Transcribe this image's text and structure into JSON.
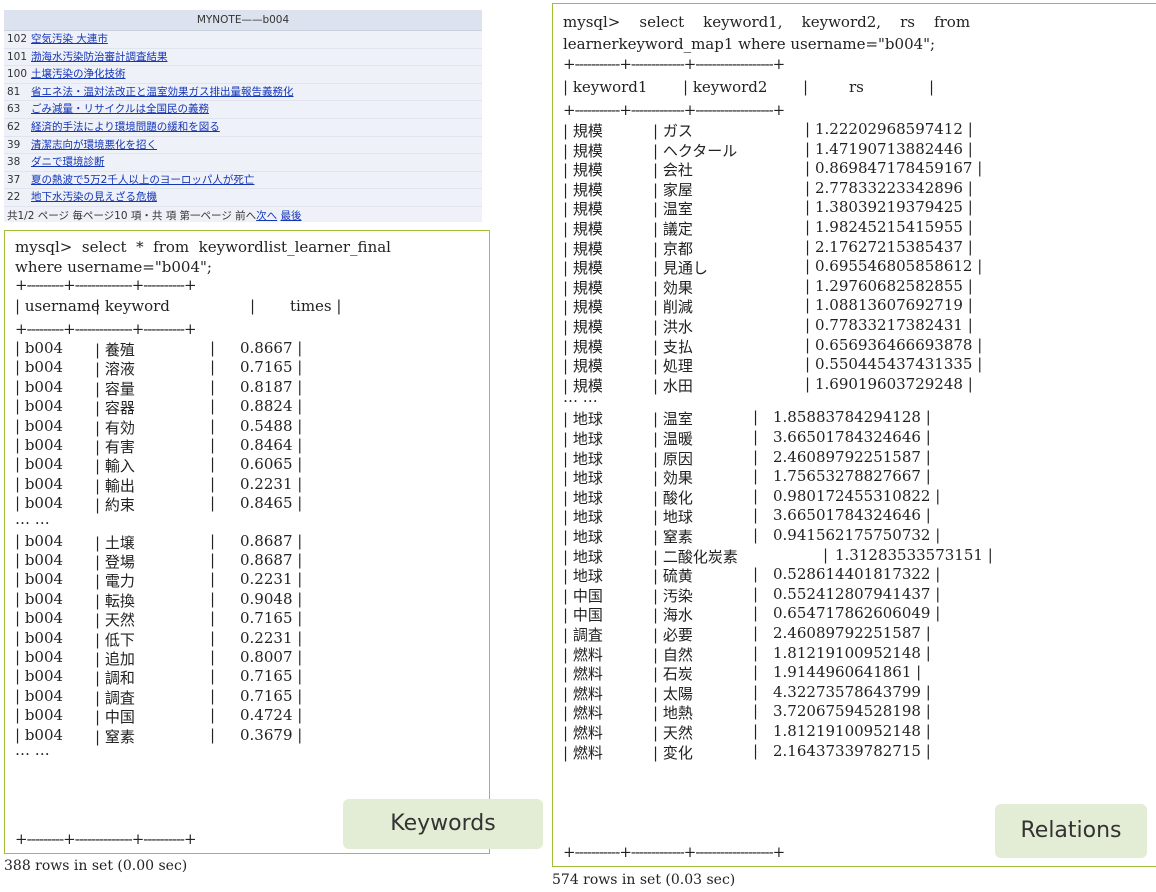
{
  "mynote": {
    "title": "MYNOTE——b004",
    "rows": [
      {
        "num": "102",
        "text": "空気汚染 大連市"
      },
      {
        "num": "101",
        "text": "渤海水汚染防治審計調査結果"
      },
      {
        "num": "100",
        "text": "土壌汚染の浄化技術"
      },
      {
        "num": "81",
        "text": "省エネ法・温対法改正と温室効果ガス排出量報告義務化"
      },
      {
        "num": "63",
        "text": "ごみ減量・リサイクルは全国民の義務"
      },
      {
        "num": "62",
        "text": "経済的手法により環境問題の緩和を図る"
      },
      {
        "num": "39",
        "text": "清潔志向が環境悪化を招く"
      },
      {
        "num": "38",
        "text": "ダニで環境診断"
      },
      {
        "num": "37",
        "text": "夏の熱波で5万2千人以上のヨーロッパ人が死亡"
      },
      {
        "num": "22",
        "text": "地下水汚染の見えざる危機"
      }
    ],
    "footer_text": "共1/2 ページ 毎ページ10 項・共 項 第一ページ 前へ",
    "footer_next": "次へ",
    "footer_last": "最後"
  },
  "keywords_panel": {
    "query_line1": "mysql>  select  *  from  keywordlist_learner_final",
    "query_line2": "where username=\"b004\";",
    "separator": "+---------+--------------+----------+",
    "headers": [
      "| username",
      "| keyword",
      "|",
      "times |"
    ],
    "rows_a": [
      [
        "| b004",
        "| 養殖",
        "|",
        "0.8667 |"
      ],
      [
        "| b004",
        "| 溶液",
        "|",
        "0.7165 |"
      ],
      [
        "| b004",
        "| 容量",
        "|",
        "0.8187 |"
      ],
      [
        "| b004",
        "| 容器",
        "|",
        "0.8824 |"
      ],
      [
        "| b004",
        "| 有効",
        "|",
        "0.5488 |"
      ],
      [
        "| b004",
        "| 有害",
        "|",
        "0.8464 |"
      ],
      [
        "| b004",
        "| 輸入",
        "|",
        "0.6065 |"
      ],
      [
        "| b004",
        "| 輸出",
        "|",
        "0.2231 |"
      ],
      [
        "| b004",
        "| 約束",
        "|",
        "0.8465 |"
      ]
    ],
    "ellipsis": "… …",
    "rows_b": [
      [
        "| b004",
        "| 土壌",
        "|",
        "0.8687 |"
      ],
      [
        "| b004",
        "| 登場",
        "|",
        "0.8687 |"
      ],
      [
        "| b004",
        "| 電力",
        "|",
        "0.2231 |"
      ],
      [
        "| b004",
        "| 転換",
        "|",
        "0.9048 |"
      ],
      [
        "| b004",
        "| 天然",
        "|",
        "0.7165 |"
      ],
      [
        "| b004",
        "| 低下",
        "|",
        "0.2231 |"
      ],
      [
        "| b004",
        "| 追加",
        "|",
        "0.8007 |"
      ],
      [
        "| b004",
        "| 調和",
        "|",
        "0.7165 |"
      ],
      [
        "| b004",
        "| 調査",
        "|",
        "0.7165 |"
      ],
      [
        "| b004",
        "| 中国",
        "|",
        "0.4724 |"
      ],
      [
        "| b004",
        "| 窒素",
        "|",
        "0.3679 |"
      ]
    ],
    "status": "388 rows in set (0.00 sec)",
    "label": "Keywords"
  },
  "relations_panel": {
    "query_line1": "mysql>    select    keyword1,    keyword2,    rs    from",
    "query_line2": "learnerkeyword_map1 where username=\"b004\";",
    "separator": "+-----------+-------------+-------------------+",
    "headers": [
      "| keyword1",
      "| keyword2",
      "|",
      "rs",
      "|"
    ],
    "rows_a": [
      [
        "| 規模",
        "| ガス",
        "|",
        "1.22202968597412 |"
      ],
      [
        "| 規模",
        "| ヘクタール",
        "|",
        "1.47190713882446 |"
      ],
      [
        "| 規模",
        "| 会社",
        "|",
        "0.869847178459167 |"
      ],
      [
        "| 規模",
        "| 家屋",
        "|",
        "2.77833223342896 |"
      ],
      [
        "| 規模",
        "| 温室",
        "|",
        "1.38039219379425 |"
      ],
      [
        "| 規模",
        "| 議定",
        "|",
        "1.98245215415955 |"
      ],
      [
        "| 規模",
        "| 京都",
        "|",
        "2.17627215385437 |"
      ],
      [
        "| 規模",
        "| 見通し",
        "|",
        "0.695546805858612 |"
      ],
      [
        "| 規模",
        "| 効果",
        "|",
        "1.29760682582855 |"
      ],
      [
        "| 規模",
        "| 削減",
        "|",
        "1.08813607692719 |"
      ],
      [
        "| 規模",
        "| 洪水",
        "|",
        "0.77833217382431 |"
      ],
      [
        "| 規模",
        "| 支払",
        "|",
        "0.656936466693878 |"
      ],
      [
        "| 規模",
        "| 処理",
        "|",
        "0.550445437431335 |"
      ],
      [
        "| 規模",
        "| 水田",
        "|",
        "1.69019603729248 |"
      ]
    ],
    "ellipsis": "… …",
    "rows_b": [
      [
        "| 地球",
        "| 温室",
        "|",
        "1.85883784294128 |"
      ],
      [
        "| 地球",
        "| 温暖",
        "|",
        "3.66501784324646 |"
      ],
      [
        "| 地球",
        "| 原因",
        "|",
        "2.46089792251587 |"
      ],
      [
        "| 地球",
        "| 効果",
        "|",
        "1.75653278827667 |"
      ],
      [
        "| 地球",
        "| 酸化",
        "|",
        "0.980172455310822 |"
      ],
      [
        "| 地球",
        "| 地球",
        "|",
        "3.66501784324646 |"
      ],
      [
        "| 地球",
        "| 窒素",
        "|",
        "0.941562175750732 |"
      ],
      [
        "| 地球",
        "| 二酸化炭素",
        "|",
        "1.31283533573151 |"
      ],
      [
        "| 地球",
        "| 硫黄",
        "|",
        "0.528614401817322 |"
      ],
      [
        "| 中国",
        "| 汚染",
        "|",
        "0.552412807941437 |"
      ],
      [
        "| 中国",
        "| 海水",
        "|",
        "0.654717862606049 |"
      ],
      [
        "| 調査",
        "| 必要",
        "|",
        "2.46089792251587 |"
      ],
      [
        "| 燃料",
        "| 自然",
        "|",
        "1.81219100952148 |"
      ],
      [
        "| 燃料",
        "| 石炭",
        "|",
        "1.9144960641861 |"
      ],
      [
        "| 燃料",
        "| 太陽",
        "|",
        "4.32273578643799 |"
      ],
      [
        "| 燃料",
        "| 地熱",
        "|",
        "3.72067594528198 |"
      ],
      [
        "| 燃料",
        "| 天然",
        "|",
        "1.81219100952148 |"
      ],
      [
        "| 燃料",
        "| 変化",
        "|",
        "2.16437339782715 |"
      ]
    ],
    "status": "574 rows in set (0.03 sec)",
    "label": "Relations"
  }
}
